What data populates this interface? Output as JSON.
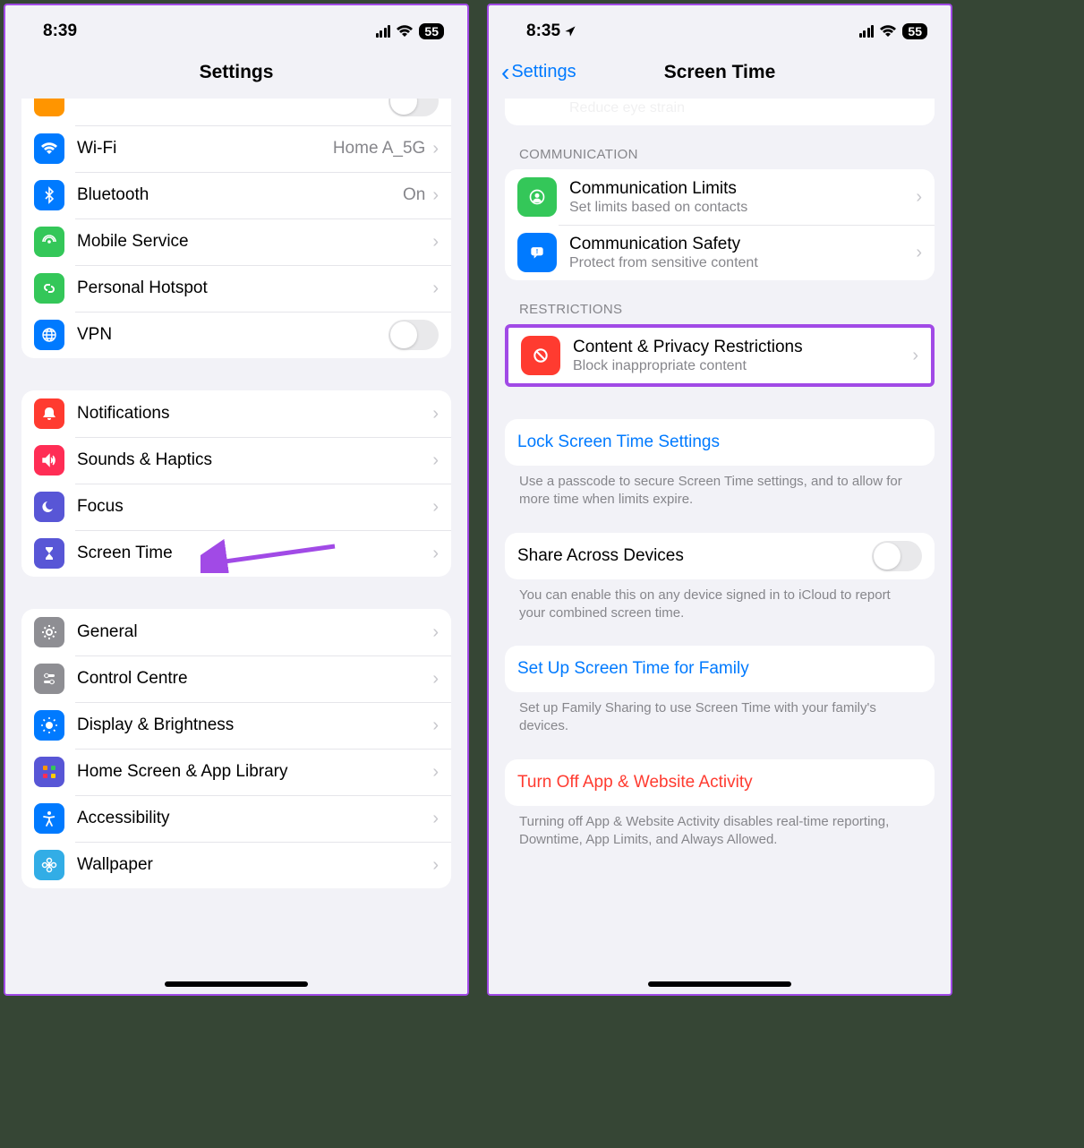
{
  "left": {
    "status": {
      "time": "8:39",
      "battery": "55"
    },
    "nav_title": "Settings",
    "rows_group1": [
      {
        "title": "",
        "value": "",
        "icon": "orange"
      },
      {
        "title": "Wi-Fi",
        "value": "Home A_5G"
      },
      {
        "title": "Bluetooth",
        "value": "On"
      },
      {
        "title": "Mobile Service",
        "value": ""
      },
      {
        "title": "Personal Hotspot",
        "value": ""
      },
      {
        "title": "VPN",
        "value": ""
      }
    ],
    "rows_group2": [
      {
        "title": "Notifications"
      },
      {
        "title": "Sounds & Haptics"
      },
      {
        "title": "Focus"
      },
      {
        "title": "Screen Time"
      }
    ],
    "rows_group3": [
      {
        "title": "General"
      },
      {
        "title": "Control Centre"
      },
      {
        "title": "Display & Brightness"
      },
      {
        "title": "Home Screen & App Library"
      },
      {
        "title": "Accessibility"
      },
      {
        "title": "Wallpaper"
      }
    ]
  },
  "right": {
    "status": {
      "time": "8:35",
      "battery": "55"
    },
    "nav_back": "Settings",
    "nav_title": "Screen Time",
    "cutoff_sub": "Reduce eye strain",
    "section1": "COMMUNICATION",
    "comm": [
      {
        "title": "Communication Limits",
        "sub": "Set limits based on contacts"
      },
      {
        "title": "Communication Safety",
        "sub": "Protect from sensitive content"
      }
    ],
    "section2": "RESTRICTIONS",
    "restrict": {
      "title": "Content & Privacy Restrictions",
      "sub": "Block inappropriate content"
    },
    "lock_link": "Lock Screen Time Settings",
    "lock_footer": "Use a passcode to secure Screen Time settings, and to allow for more time when limits expire.",
    "share_title": "Share Across Devices",
    "share_footer": "You can enable this on any device signed in to iCloud to report your combined screen time.",
    "family_link": "Set Up Screen Time for Family",
    "family_footer": "Set up Family Sharing to use Screen Time with your family's devices.",
    "turnoff_link": "Turn Off App & Website Activity",
    "turnoff_footer": "Turning off App & Website Activity disables real-time reporting, Downtime, App Limits, and Always Allowed."
  }
}
